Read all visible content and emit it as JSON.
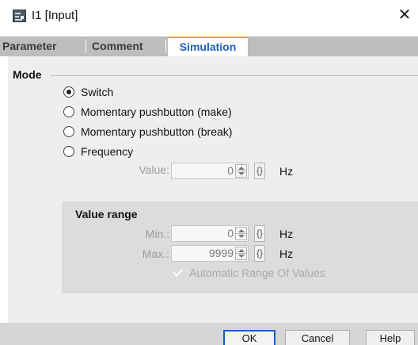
{
  "window": {
    "title": "I1 [Input]",
    "close_glyph": "✕",
    "app_icon": "logo-block-icon"
  },
  "tabs": [
    {
      "label": "Parameter",
      "active": false
    },
    {
      "label": "Comment",
      "active": false
    },
    {
      "label": "Simulation",
      "active": true
    }
  ],
  "mode": {
    "title": "Mode",
    "options": [
      {
        "label": "Switch",
        "checked": true
      },
      {
        "label": "Momentary pushbutton (make)",
        "checked": false
      },
      {
        "label": "Momentary pushbutton (break)",
        "checked": false
      },
      {
        "label": "Frequency",
        "checked": false
      }
    ],
    "value_label": "Value:",
    "value": "0",
    "brace_glyph": "{}",
    "unit": "Hz"
  },
  "value_range": {
    "title": "Value range",
    "min_label": "Min.:",
    "min_value": "0",
    "max_label": "Max.:",
    "max_value": "9999",
    "unit": "Hz",
    "brace_glyph": "{}",
    "auto_label": "Automatic Range Of Values",
    "auto_checked": true
  },
  "buttons": {
    "ok": "OK",
    "cancel": "Cancel",
    "help": "Help"
  },
  "colors": {
    "active_tab_text": "#1f5fbf",
    "active_tab_accent": "#e8a63a",
    "default_button_border": "#0a64c8"
  }
}
